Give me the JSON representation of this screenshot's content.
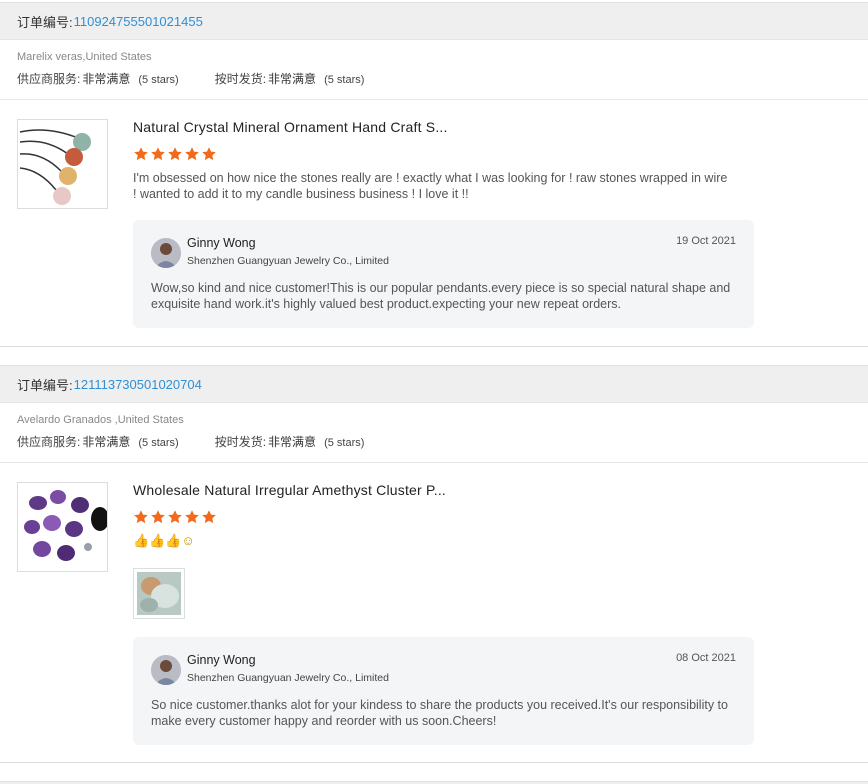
{
  "orders": [
    {
      "order_label": "订单编号:",
      "order_number": "110924755501021455",
      "buyer": "Marelix veras,United States",
      "supplier_service": {
        "label": "供应商服务:",
        "value": "非常满意",
        "stars_text": "(5 stars)"
      },
      "on_time_delivery": {
        "label": "按时发货:",
        "value": "非常满意",
        "stars_text": "(5 stars)"
      },
      "product_title": "Natural Crystal Mineral Ornament Hand Craft S...",
      "rating": 5,
      "review": "I'm obsessed on how nice the stones really are ! exactly what I was looking for ! raw stones wrapped in wire ! wanted to add it to my candle business business !  I love it !!",
      "reply": {
        "name": "Ginny Wong",
        "company": "Shenzhen Guangyuan Jewelry Co., Limited",
        "date": "19 Oct 2021",
        "text": "Wow,so kind and nice customer!This is our popular pendants.every piece is so special natural shape and exquisite hand work.it's highly valued best product.expecting your new repeat orders."
      }
    },
    {
      "order_label": "订单编号:",
      "order_number": "121113730501020704",
      "buyer": "Avelardo Granados ,United States",
      "supplier_service": {
        "label": "供应商服务:",
        "value": "非常满意",
        "stars_text": "(5 stars)"
      },
      "on_time_delivery": {
        "label": "按时发货:",
        "value": "非常满意",
        "stars_text": "(5 stars)"
      },
      "product_title": "Wholesale Natural Irregular Amethyst Cluster P...",
      "rating": 5,
      "review": "👍👍👍☺",
      "reply": {
        "name": "Ginny Wong",
        "company": "Shenzhen Guangyuan Jewelry Co., Limited",
        "date": "08 Oct 2021",
        "text": "So nice customer.thanks alot for your kindess to share the products you received.It's our responsibility to make every customer happy and reorder with us soon.Cheers!"
      }
    }
  ],
  "colors": {
    "accent": "#2f8fd6",
    "star": "#f26b1d",
    "reply_bg": "#f4f5f7"
  }
}
